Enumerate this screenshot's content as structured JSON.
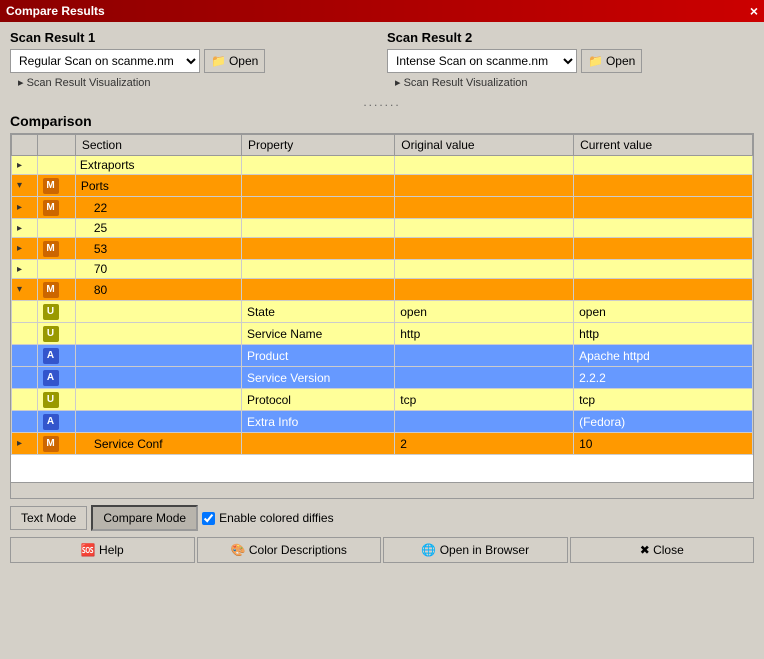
{
  "titleBar": {
    "title": "Compare Results",
    "closeIcon": "×"
  },
  "scanResult1": {
    "label": "Scan Result 1",
    "selectedOption": "Regular Scan on scanme.nm",
    "openLabel": "Open",
    "visLabel": "Scan Result Visualization"
  },
  "scanResult2": {
    "label": "Scan Result 2",
    "selectedOption": "Intense Scan on scanme.nm",
    "openLabel": "Open",
    "visLabel": "Scan Result Visualization"
  },
  "divider": ".......",
  "comparison": {
    "label": "Comparison",
    "columns": [
      "Section",
      "Property",
      "Original value",
      "Current value"
    ],
    "rows": [
      {
        "indent": 1,
        "arrow": "▸",
        "badge": "",
        "section": "Extraports",
        "property": "",
        "original": "",
        "current": "",
        "rowClass": "row-yellow"
      },
      {
        "indent": 0,
        "arrow": "▾",
        "badge": "M",
        "badgeClass": "badge-m",
        "section": "Ports",
        "property": "",
        "original": "",
        "current": "",
        "rowClass": "row-orange"
      },
      {
        "indent": 2,
        "arrow": "▸",
        "badge": "M",
        "badgeClass": "badge-m",
        "section": "22",
        "property": "",
        "original": "",
        "current": "",
        "rowClass": "row-orange"
      },
      {
        "indent": 2,
        "arrow": "▸",
        "badge": "",
        "section": "25",
        "property": "",
        "original": "",
        "current": "",
        "rowClass": "row-yellow"
      },
      {
        "indent": 2,
        "arrow": "▸",
        "badge": "M",
        "badgeClass": "badge-m",
        "section": "53",
        "property": "",
        "original": "",
        "current": "",
        "rowClass": "row-orange"
      },
      {
        "indent": 2,
        "arrow": "▸",
        "badge": "",
        "section": "70",
        "property": "",
        "original": "",
        "current": "",
        "rowClass": "row-yellow"
      },
      {
        "indent": 2,
        "arrow": "▾",
        "badge": "M",
        "badgeClass": "badge-m",
        "section": "80",
        "property": "",
        "original": "",
        "current": "",
        "rowClass": "row-orange"
      },
      {
        "indent": 3,
        "arrow": "",
        "badge": "U",
        "badgeClass": "badge-u",
        "section": "",
        "property": "State",
        "original": "open",
        "current": "open",
        "rowClass": "row-yellow"
      },
      {
        "indent": 3,
        "arrow": "",
        "badge": "U",
        "badgeClass": "badge-u",
        "section": "",
        "property": "Service Name",
        "original": "http",
        "current": "http",
        "rowClass": "row-yellow"
      },
      {
        "indent": 3,
        "arrow": "",
        "badge": "A",
        "badgeClass": "badge-a",
        "section": "",
        "property": "Product",
        "original": "",
        "current": "Apache httpd",
        "rowClass": "row-blue"
      },
      {
        "indent": 3,
        "arrow": "",
        "badge": "A",
        "badgeClass": "badge-a",
        "section": "",
        "property": "Service Version",
        "original": "",
        "current": "2.2.2",
        "rowClass": "row-blue"
      },
      {
        "indent": 3,
        "arrow": "",
        "badge": "U",
        "badgeClass": "badge-u",
        "section": "",
        "property": "Protocol",
        "original": "tcp",
        "current": "tcp",
        "rowClass": "row-yellow"
      },
      {
        "indent": 3,
        "arrow": "",
        "badge": "A",
        "badgeClass": "badge-a",
        "section": "",
        "property": "Extra Info",
        "original": "",
        "current": "(Fedora)",
        "rowClass": "row-blue"
      },
      {
        "indent": 2,
        "arrow": "▸",
        "badge": "M",
        "badgeClass": "badge-m",
        "section": "Service Conf",
        "property": "",
        "original": "2",
        "current": "10",
        "rowClass": "row-orange"
      }
    ]
  },
  "footer": {
    "textModeLabel": "Text Mode",
    "compareModeLabel": "Compare Mode",
    "enableColoredLabel": "Enable colored diffies",
    "helpLabel": "Help",
    "colorDescLabel": "Color Descriptions",
    "openBrowserLabel": "Open in Browser",
    "closeLabel": "Close"
  }
}
